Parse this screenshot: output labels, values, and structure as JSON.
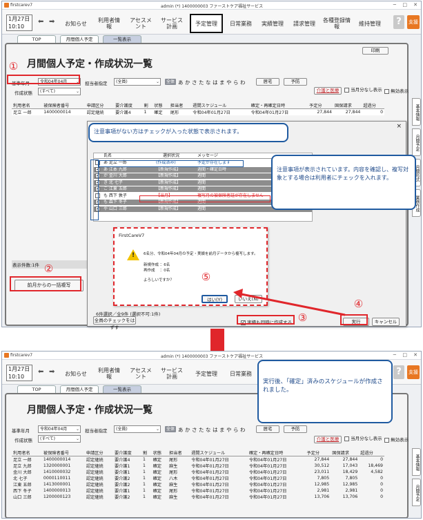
{
  "app": {
    "name": "firstcarev7",
    "window_title": "admin (*) 1400000003 ファーストケア福祉サービス"
  },
  "toolbar": {
    "date": "1月27日",
    "time": "10:10",
    "menus": [
      "お知らせ",
      "利用者情報",
      "アセスメント",
      "サービス計画",
      "予定管理",
      "日常業務",
      "実績管理",
      "請求管理",
      "各種登録情報",
      "維持管理"
    ],
    "help": "?",
    "support": "支援"
  },
  "tabs": [
    "TOP",
    "月間個人予定",
    "一覧表示"
  ],
  "page": {
    "title": "月間個人予定・作成状況一覧",
    "print_label": "印刷",
    "base_month_label": "基準年月",
    "base_month_value": "令和04年04月",
    "staff_label": "担当者指定",
    "staff_value": "(全員)",
    "all_label": "全体",
    "kana": "あかさたなはまやらわ",
    "kyotaku_label": "居宅",
    "yobo_label": "予防",
    "status_label": "作成状態",
    "status_value": "(すべて)",
    "care_link": "介護と医療",
    "monthly_check": "当月分なし表示",
    "invalid_check": "無効表示",
    "count_label": "表示件数:1件",
    "copy_button": "前月からの一括複写",
    "sidetabs": [
      "基本情報",
      "月間予定",
      "月間形式",
      "業務作成"
    ]
  },
  "table_headers": [
    "利用者名",
    "被保険者番号",
    "申請区分",
    "要介護度",
    "割",
    "状態",
    "担当者",
    "週間スケジュール",
    "確定・再確定日時",
    "予定分",
    "国保請求",
    "超過分"
  ],
  "table_before": [
    [
      "足立 一郎",
      "1400000014",
      "認定継続",
      "要介護4",
      "1",
      "確定",
      "尾形",
      "令和04年01月27日",
      "令和04年01月27日",
      "27,844",
      "27,844",
      "0"
    ]
  ],
  "dialog": {
    "title": "FirstCareV7",
    "header_name": "氏名",
    "header_status": "選択状況",
    "header_message": "メッセージ",
    "rows": [
      {
        "name": "あ 足立 一郎",
        "status": "(作成済み)",
        "message": "予定が存在します",
        "checked": false,
        "dark": false
      },
      {
        "name": "あ 江本 九郎",
        "status": "【新規作成】",
        "message": "週間・確定日時",
        "checked": true,
        "dark": true
      },
      {
        "name": "か 金川 大郎",
        "status": "【新規作成】",
        "message": "週間",
        "checked": true,
        "dark": true
      },
      {
        "name": "き 北 七子",
        "status": "【新規作成】",
        "message": "週間",
        "checked": true,
        "dark": true
      },
      {
        "name": "こ 江東 五郎",
        "status": "【新規作成】",
        "message": "週間",
        "checked": true,
        "dark": true
      },
      {
        "name": "も 西下 敦子",
        "status": "【当月】",
        "message": "複写月の被保険者証が存在しません",
        "checked": false,
        "dark": false
      },
      {
        "name": "も 森下 冬子",
        "status": "【新規作成】",
        "message": "週間",
        "checked": true,
        "dark": true
      },
      {
        "name": "や 山口 三郎",
        "status": "【新規作成】",
        "message": "週間",
        "checked": true,
        "dark": true
      }
    ],
    "footer_text": "6件選択／全9件 (選択不可:1件)",
    "check_all_button": "全員のチェックをはずす",
    "actual_check": "実績も同時に作成する",
    "run_button": "実行",
    "cancel_button": "キャンセル",
    "close": "×"
  },
  "confirm": {
    "title": "FirstCareV7",
    "line1": "6名分、令和04年04月の予定・実績を前月データから複写します。",
    "line2": "新規作成 ：6名",
    "line3": "再作成　 ：0名",
    "line4": "よろしいですか？",
    "yes": "はい(Y)",
    "no": "いいえ(N)"
  },
  "callouts": {
    "c1": "注意事項がない方はチェックが入った状態で表示されます。",
    "c2": "注意事項が表示されています。内容を確認し、複写対象とする場合は利用者にチェックを入れます。",
    "c3": "実行後、「確定」済みのスケジュールが作成されました。"
  },
  "steps": [
    "①",
    "②",
    "③",
    "④",
    "⑤"
  ],
  "table_after": [
    [
      "足立 一郎",
      "1400000014",
      "認定継続",
      "要介護4",
      "1",
      "確定",
      "尾形",
      "令和04年01月27日",
      "令和04年01月27日",
      "27,844",
      "27,844",
      "0"
    ],
    [
      "足立 九郎",
      "1320000001",
      "認定継続",
      "要介護1",
      "1",
      "確定",
      "麻生",
      "令和04年01月27日",
      "令和04年01月27日",
      "30,512",
      "17,043",
      "18,469"
    ],
    [
      "金川 大郎",
      "1410000032",
      "認定継続",
      "要介護1",
      "1",
      "確定",
      "尾形",
      "令和04年01月27日",
      "令和04年01月27日",
      "23,011",
      "18,429",
      "4,582"
    ],
    [
      "北 七子",
      "0000110011",
      "認定継続",
      "要介護2",
      "1",
      "確定",
      "八木",
      "令和04年01月27日",
      "令和04年01月27日",
      "7,805",
      "7,805",
      "0"
    ],
    [
      "江東 五郎",
      "1413000001",
      "認定継続",
      "要介護2",
      "1",
      "確定",
      "麻生",
      "令和04年01月27日",
      "令和04年01月27日",
      "12,985",
      "12,985",
      "0"
    ],
    [
      "西下 冬子",
      "1400000013",
      "認定継続",
      "要介護1",
      "1",
      "確定",
      "尾形",
      "令和04年01月27日",
      "令和04年01月27日",
      "2,981",
      "2,981",
      "0"
    ],
    [
      "山口 三郎",
      "1200000123",
      "認定継続",
      "要介護2",
      "1",
      "確定",
      "麻生",
      "令和04年01月27日",
      "令和04年01月27日",
      "13,706",
      "13,706",
      "0"
    ]
  ],
  "colors": {
    "red": "#e0262b",
    "blue": "#1f5aa0",
    "accent": "#e87722"
  }
}
